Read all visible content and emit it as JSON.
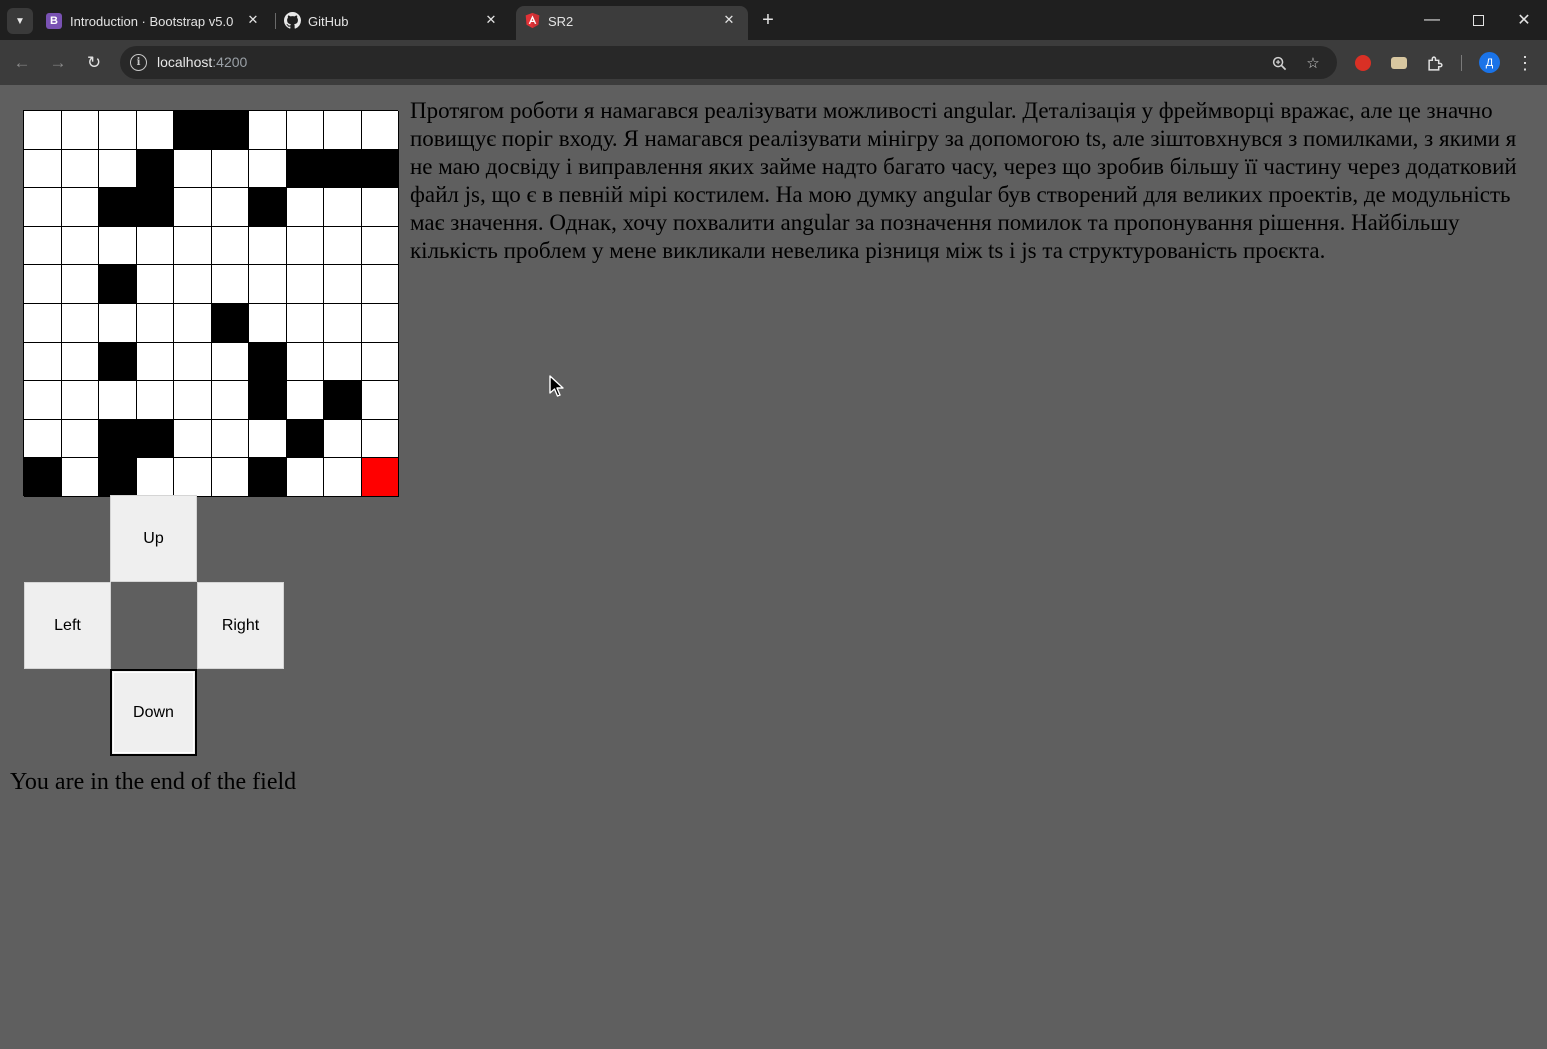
{
  "browser": {
    "tabs": [
      {
        "title": "Introduction · Bootstrap v5.0",
        "favicon": "bootstrap-icon",
        "favicon_letter": "B"
      },
      {
        "title": "GitHub",
        "favicon": "github-icon"
      },
      {
        "title": "SR2",
        "favicon": "angular-icon",
        "active": true
      }
    ],
    "url_host": "localhost",
    "url_port": ":4200",
    "profile_initial": "Д"
  },
  "game": {
    "grid_rows": 10,
    "grid_cols": 10,
    "walls": [
      [
        0,
        4
      ],
      [
        0,
        5
      ],
      [
        1,
        3
      ],
      [
        1,
        7
      ],
      [
        1,
        8
      ],
      [
        1,
        9
      ],
      [
        2,
        2
      ],
      [
        2,
        3
      ],
      [
        2,
        6
      ],
      [
        4,
        2
      ],
      [
        5,
        5
      ],
      [
        6,
        2
      ],
      [
        6,
        6
      ],
      [
        7,
        6
      ],
      [
        7,
        8
      ],
      [
        8,
        2
      ],
      [
        8,
        3
      ],
      [
        8,
        7
      ],
      [
        9,
        0
      ],
      [
        9,
        2
      ],
      [
        9,
        6
      ]
    ],
    "player": [
      9,
      9
    ],
    "player_color": "#ff0000",
    "controls": {
      "up": "Up",
      "left": "Left",
      "right": "Right",
      "down": "Down"
    },
    "status_message": "You are in the end of the field"
  },
  "description": "Протягом роботи я намагався реалізувати можливості angular. Деталізація у фреймворці вражає, але це значно повищує поріг входу. Я намагався реалізувати мінігру за допомогою ts, але зіштовхнувся з помилками, з якими я не маю досвіду і виправлення яких займе надто багато часу, через що зробив більшу її частину через додатковий файл js, що є в певній мірі костилем. На мою думку angular був створений для великих проектів, де модульність має значення. Однак, хочу похвалити angular за позначення помилок та пропонування рішення. Найбільшу кількість проблем у мене викликали невелика різниця між ts і js та структурованість проєкта."
}
